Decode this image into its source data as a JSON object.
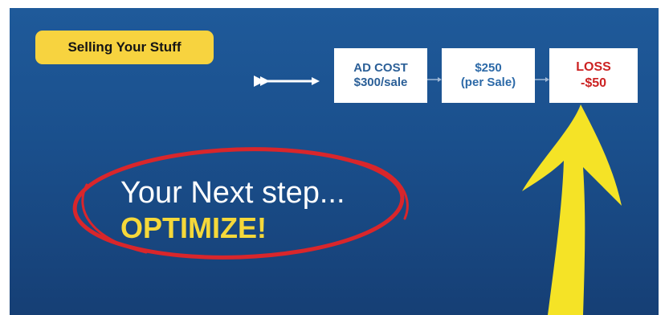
{
  "tag": {
    "label": "Selling Your Stuff"
  },
  "flow": {
    "boxes": [
      {
        "line1": "AD COST",
        "line2": "$300/sale"
      },
      {
        "line1": "$250",
        "line2": "(per Sale)"
      },
      {
        "line1": "LOSS",
        "line2": "-$50"
      }
    ]
  },
  "headline": {
    "line1": "Your Next step...",
    "line2": "OPTIMIZE!"
  },
  "colors": {
    "background": "#1a4f8c",
    "accent_yellow": "#f7d33f",
    "loss_red": "#cc2222",
    "circle_red": "#d9262b"
  }
}
